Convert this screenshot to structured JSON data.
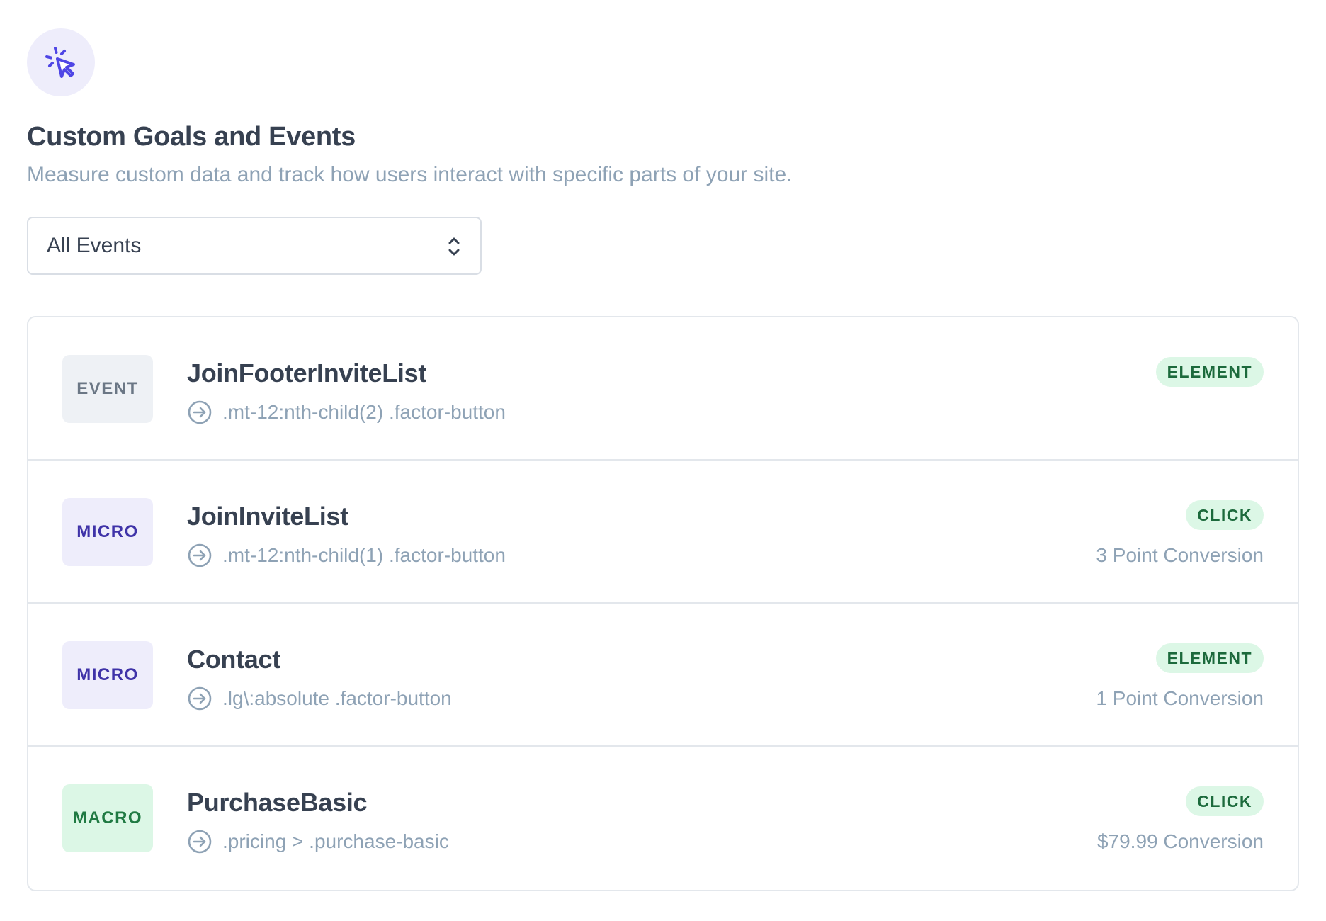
{
  "header": {
    "icon": "cursor-click-icon",
    "accent_color": "#4f46e5",
    "title": "Custom Goals and Events",
    "subtitle": "Measure custom data and track how users interact with specific parts of your site."
  },
  "filter": {
    "selected": "All Events"
  },
  "events": [
    {
      "type": "EVENT",
      "name": "JoinFooterInviteList",
      "selector": ".mt-12:nth-child(2) .factor-button",
      "kind": "ELEMENT",
      "conversion": ""
    },
    {
      "type": "MICRO",
      "name": "JoinInviteList",
      "selector": ".mt-12:nth-child(1) .factor-button",
      "kind": "CLICK",
      "conversion": "3 Point Conversion"
    },
    {
      "type": "MICRO",
      "name": "Contact",
      "selector": ".lg\\:absolute .factor-button",
      "kind": "ELEMENT",
      "conversion": "1 Point Conversion"
    },
    {
      "type": "MACRO",
      "name": "PurchaseBasic",
      "selector": ".pricing > .purchase-basic",
      "kind": "CLICK",
      "conversion": "$79.99 Conversion"
    }
  ]
}
